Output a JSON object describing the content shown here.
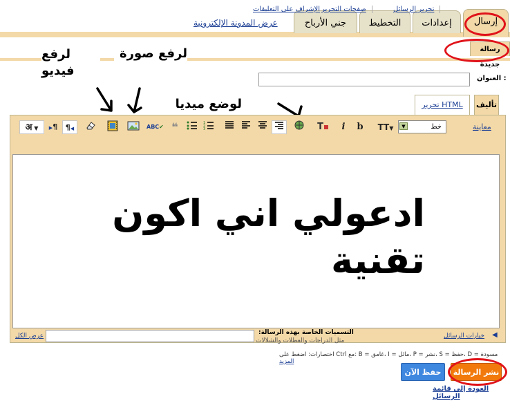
{
  "top_tabs": {
    "posting": "إرسال",
    "settings": "إعدادات",
    "layout": "التخطيط",
    "monetize": "جني الأرباح",
    "view_blog": "عرض المدونة الإلكترونية"
  },
  "sub_tabs": {
    "new_post": "رسالة جديدة",
    "edit_posts": "تحرير الرسائل",
    "edit_pages": "صفحات التحرير",
    "moderate_comments": "الإشراف على التعليقات"
  },
  "annotations": {
    "upload_video": "لرفع فيديو",
    "upload_image": "لرفع صورة",
    "add_media": "لوضع ميديا"
  },
  "title_label": "العنوان :",
  "editor_tabs": {
    "compose": "تأليف",
    "edit_html": "تحرير HTML"
  },
  "toolbar": {
    "preview": "معاينة",
    "font_value": "خط",
    "font_size": "TT",
    "bold": "b",
    "italic": "i",
    "text_color": "T",
    "spellcheck": "ABC",
    "quote": "❝",
    "ltr": "¶",
    "rtl": "¶",
    "lang": "अ"
  },
  "editor_body": "ادعولي اني اكون تقنية",
  "labels": {
    "title": "التسميات الخاصة بهذه الرسالة:",
    "example": "مثل الدراجات والعطلات والشلالات",
    "show_all": "عرض الكل"
  },
  "post_options": "خيارات الرسائل",
  "shortcuts": "اختصارات: اضغط على Ctrl مع: B = غامق، I = مائل، P = نشر، S = حفظ، D = مسودة",
  "shortcuts_more": "المزيد",
  "buttons": {
    "publish": "نشر الرسالة",
    "save": "حفظ الآن"
  },
  "back_link": "العودة إلى قائمة الرسائل",
  "colors": {
    "accent_tan": "#f3d9a8",
    "highlight_red": "#e0131a",
    "publish_orange": "#f27a0c",
    "save_blue": "#3f88e0",
    "link_blue": "#1c3f94"
  }
}
